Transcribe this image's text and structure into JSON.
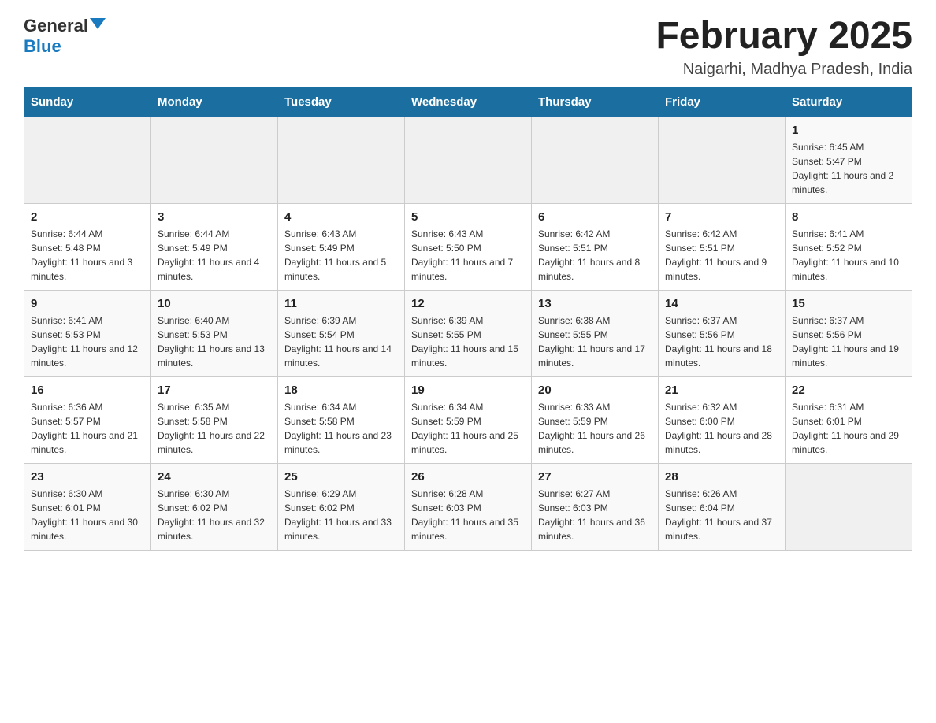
{
  "logo": {
    "general": "General",
    "blue": "Blue"
  },
  "title": "February 2025",
  "subtitle": "Naigarhi, Madhya Pradesh, India",
  "days_of_week": [
    "Sunday",
    "Monday",
    "Tuesday",
    "Wednesday",
    "Thursday",
    "Friday",
    "Saturday"
  ],
  "weeks": [
    [
      {
        "day": "",
        "sunrise": "",
        "sunset": "",
        "daylight": ""
      },
      {
        "day": "",
        "sunrise": "",
        "sunset": "",
        "daylight": ""
      },
      {
        "day": "",
        "sunrise": "",
        "sunset": "",
        "daylight": ""
      },
      {
        "day": "",
        "sunrise": "",
        "sunset": "",
        "daylight": ""
      },
      {
        "day": "",
        "sunrise": "",
        "sunset": "",
        "daylight": ""
      },
      {
        "day": "",
        "sunrise": "",
        "sunset": "",
        "daylight": ""
      },
      {
        "day": "1",
        "sunrise": "Sunrise: 6:45 AM",
        "sunset": "Sunset: 5:47 PM",
        "daylight": "Daylight: 11 hours and 2 minutes."
      }
    ],
    [
      {
        "day": "2",
        "sunrise": "Sunrise: 6:44 AM",
        "sunset": "Sunset: 5:48 PM",
        "daylight": "Daylight: 11 hours and 3 minutes."
      },
      {
        "day": "3",
        "sunrise": "Sunrise: 6:44 AM",
        "sunset": "Sunset: 5:49 PM",
        "daylight": "Daylight: 11 hours and 4 minutes."
      },
      {
        "day": "4",
        "sunrise": "Sunrise: 6:43 AM",
        "sunset": "Sunset: 5:49 PM",
        "daylight": "Daylight: 11 hours and 5 minutes."
      },
      {
        "day": "5",
        "sunrise": "Sunrise: 6:43 AM",
        "sunset": "Sunset: 5:50 PM",
        "daylight": "Daylight: 11 hours and 7 minutes."
      },
      {
        "day": "6",
        "sunrise": "Sunrise: 6:42 AM",
        "sunset": "Sunset: 5:51 PM",
        "daylight": "Daylight: 11 hours and 8 minutes."
      },
      {
        "day": "7",
        "sunrise": "Sunrise: 6:42 AM",
        "sunset": "Sunset: 5:51 PM",
        "daylight": "Daylight: 11 hours and 9 minutes."
      },
      {
        "day": "8",
        "sunrise": "Sunrise: 6:41 AM",
        "sunset": "Sunset: 5:52 PM",
        "daylight": "Daylight: 11 hours and 10 minutes."
      }
    ],
    [
      {
        "day": "9",
        "sunrise": "Sunrise: 6:41 AM",
        "sunset": "Sunset: 5:53 PM",
        "daylight": "Daylight: 11 hours and 12 minutes."
      },
      {
        "day": "10",
        "sunrise": "Sunrise: 6:40 AM",
        "sunset": "Sunset: 5:53 PM",
        "daylight": "Daylight: 11 hours and 13 minutes."
      },
      {
        "day": "11",
        "sunrise": "Sunrise: 6:39 AM",
        "sunset": "Sunset: 5:54 PM",
        "daylight": "Daylight: 11 hours and 14 minutes."
      },
      {
        "day": "12",
        "sunrise": "Sunrise: 6:39 AM",
        "sunset": "Sunset: 5:55 PM",
        "daylight": "Daylight: 11 hours and 15 minutes."
      },
      {
        "day": "13",
        "sunrise": "Sunrise: 6:38 AM",
        "sunset": "Sunset: 5:55 PM",
        "daylight": "Daylight: 11 hours and 17 minutes."
      },
      {
        "day": "14",
        "sunrise": "Sunrise: 6:37 AM",
        "sunset": "Sunset: 5:56 PM",
        "daylight": "Daylight: 11 hours and 18 minutes."
      },
      {
        "day": "15",
        "sunrise": "Sunrise: 6:37 AM",
        "sunset": "Sunset: 5:56 PM",
        "daylight": "Daylight: 11 hours and 19 minutes."
      }
    ],
    [
      {
        "day": "16",
        "sunrise": "Sunrise: 6:36 AM",
        "sunset": "Sunset: 5:57 PM",
        "daylight": "Daylight: 11 hours and 21 minutes."
      },
      {
        "day": "17",
        "sunrise": "Sunrise: 6:35 AM",
        "sunset": "Sunset: 5:58 PM",
        "daylight": "Daylight: 11 hours and 22 minutes."
      },
      {
        "day": "18",
        "sunrise": "Sunrise: 6:34 AM",
        "sunset": "Sunset: 5:58 PM",
        "daylight": "Daylight: 11 hours and 23 minutes."
      },
      {
        "day": "19",
        "sunrise": "Sunrise: 6:34 AM",
        "sunset": "Sunset: 5:59 PM",
        "daylight": "Daylight: 11 hours and 25 minutes."
      },
      {
        "day": "20",
        "sunrise": "Sunrise: 6:33 AM",
        "sunset": "Sunset: 5:59 PM",
        "daylight": "Daylight: 11 hours and 26 minutes."
      },
      {
        "day": "21",
        "sunrise": "Sunrise: 6:32 AM",
        "sunset": "Sunset: 6:00 PM",
        "daylight": "Daylight: 11 hours and 28 minutes."
      },
      {
        "day": "22",
        "sunrise": "Sunrise: 6:31 AM",
        "sunset": "Sunset: 6:01 PM",
        "daylight": "Daylight: 11 hours and 29 minutes."
      }
    ],
    [
      {
        "day": "23",
        "sunrise": "Sunrise: 6:30 AM",
        "sunset": "Sunset: 6:01 PM",
        "daylight": "Daylight: 11 hours and 30 minutes."
      },
      {
        "day": "24",
        "sunrise": "Sunrise: 6:30 AM",
        "sunset": "Sunset: 6:02 PM",
        "daylight": "Daylight: 11 hours and 32 minutes."
      },
      {
        "day": "25",
        "sunrise": "Sunrise: 6:29 AM",
        "sunset": "Sunset: 6:02 PM",
        "daylight": "Daylight: 11 hours and 33 minutes."
      },
      {
        "day": "26",
        "sunrise": "Sunrise: 6:28 AM",
        "sunset": "Sunset: 6:03 PM",
        "daylight": "Daylight: 11 hours and 35 minutes."
      },
      {
        "day": "27",
        "sunrise": "Sunrise: 6:27 AM",
        "sunset": "Sunset: 6:03 PM",
        "daylight": "Daylight: 11 hours and 36 minutes."
      },
      {
        "day": "28",
        "sunrise": "Sunrise: 6:26 AM",
        "sunset": "Sunset: 6:04 PM",
        "daylight": "Daylight: 11 hours and 37 minutes."
      },
      {
        "day": "",
        "sunrise": "",
        "sunset": "",
        "daylight": ""
      }
    ]
  ]
}
